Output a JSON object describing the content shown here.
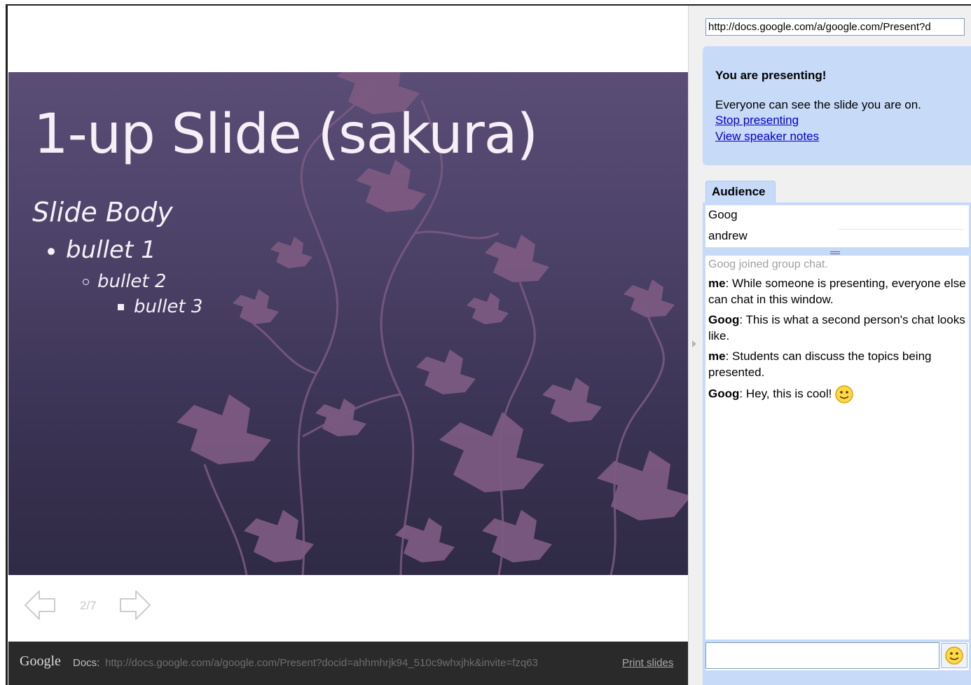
{
  "slide": {
    "title": "1-up Slide (sakura)",
    "body_heading": "Slide Body",
    "bullets": [
      "bullet 1",
      "bullet 2",
      "bullet 3"
    ]
  },
  "navigation": {
    "page_indicator": "2/7",
    "prev_icon": "left-arrow-icon",
    "next_icon": "right-arrow-icon"
  },
  "footer": {
    "logo": "Google",
    "docs_label": "Docs:",
    "url": "http://docs.google.com/a/google.com/Present?docid=ahhmhrjk94_510c9whxjhk&invite=fzq63",
    "print_link": "Print slides"
  },
  "side_panel": {
    "url_value": "http://docs.google.com/a/google.com/Present?d",
    "presenting": {
      "title": "You are presenting!",
      "message": "Everyone can see the slide you are on.",
      "stop_link": "Stop presenting",
      "notes_link": "View speaker notes"
    },
    "audience": {
      "tab_label": "Audience",
      "members": [
        "Goog",
        "andrew"
      ]
    },
    "chat": {
      "system_message": "Goog joined group chat.",
      "messages": [
        {
          "sender": "me",
          "text": ": While someone is presenting, everyone else can chat in this window."
        },
        {
          "sender": "Goog",
          "text": ": This is what a second person's chat looks like."
        },
        {
          "sender": "me",
          "text": ": Students can discuss the topics being presented."
        },
        {
          "sender": "Goog",
          "text": ": Hey, this is cool!"
        }
      ],
      "input_value": "",
      "emoji_icon": "smiley-icon"
    }
  },
  "colors": {
    "slide_bg_top": "#5a4d76",
    "slide_bg_bottom": "#2f2a45",
    "leaf": "#7c5a82",
    "panel_blue": "#c7daf8",
    "link": "#0000cc"
  }
}
